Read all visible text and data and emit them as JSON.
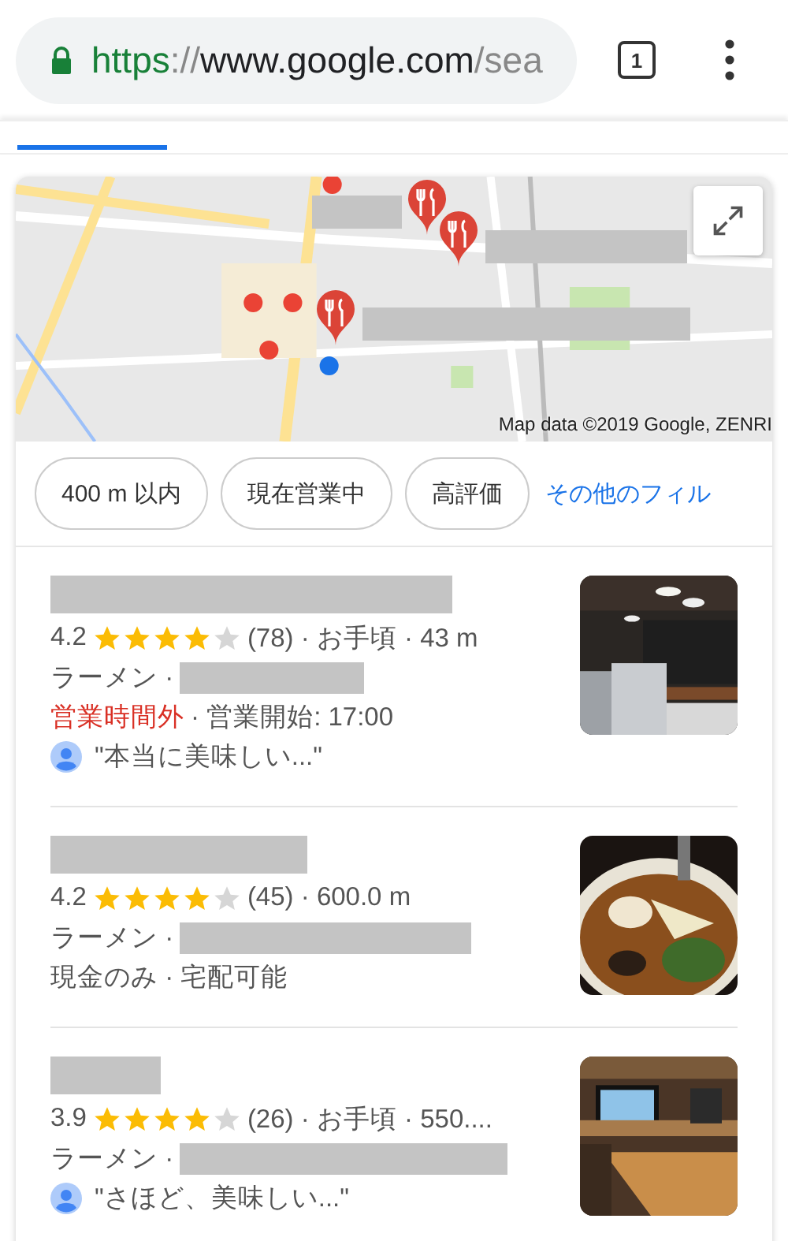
{
  "address_bar": {
    "scheme": "https",
    "separator": "://",
    "host": "www.google.com",
    "path": "/sea",
    "secure": true
  },
  "tab_count": "1",
  "map": {
    "kind": "picture",
    "attribution": "Map data ©2019 Google, ZENRI"
  },
  "filters": [
    {
      "label": "400 m 以内",
      "kind": "chip"
    },
    {
      "label": "現在営業中",
      "kind": "chip"
    },
    {
      "label": "高評価",
      "kind": "chip"
    },
    {
      "label": "その他のフィル",
      "kind": "link"
    }
  ],
  "results": [
    {
      "rating": "4.2",
      "stars": 4,
      "meta": "(78) · お手頃 · 43 m",
      "category": "ラーメン ·",
      "lines": [
        {
          "kind": "hours",
          "status": "営業時間外",
          "text": "· 営業開始: 17:00"
        },
        {
          "kind": "review",
          "text": "\"本当に美味しい...\""
        }
      ]
    },
    {
      "rating": "4.2",
      "stars": 4,
      "meta": "(45) · 600.0 m",
      "category": "ラーメン ·",
      "lines": [
        {
          "kind": "plain",
          "text": "現金のみ · 宅配可能"
        }
      ]
    },
    {
      "rating": "3.9",
      "stars": 4,
      "meta": "(26) · お手頃 · 550....",
      "category": "ラーメン ·",
      "lines": [
        {
          "kind": "review",
          "text": "\"さほど、美味しい...\""
        }
      ]
    }
  ]
}
